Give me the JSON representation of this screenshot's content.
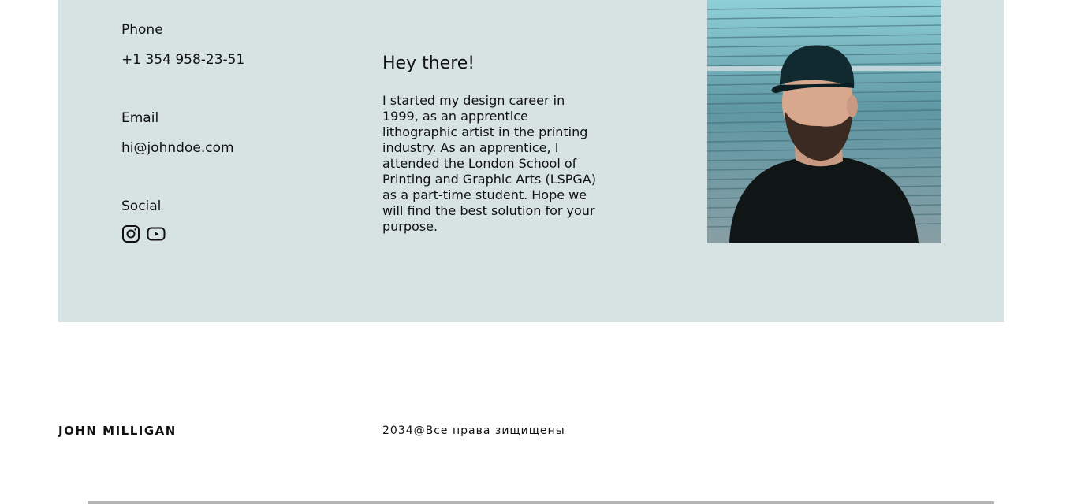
{
  "contact": {
    "phone_label": "Phone",
    "phone_value": "+1 354 958-23-51",
    "email_label": "Email",
    "email_value": "hi@johndoe.com",
    "social_label": "Social",
    "social_icons": [
      "instagram-icon",
      "youtube-icon"
    ]
  },
  "about": {
    "heading": "Hey there!",
    "body": "I started my design career in 1999, as an apprentice lithographic artist in the printing industry. As an apprentice, I attended the London School of Printing and Graphic Arts (LSPGA) as a part-time student. Hope we will find the best solution for your purpose."
  },
  "footer": {
    "name": "JOHN MILLIGAN",
    "copyright": "2034@Все права зищищены"
  },
  "colors": {
    "panel_bg": "#d7e3e3",
    "text": "#111111"
  }
}
